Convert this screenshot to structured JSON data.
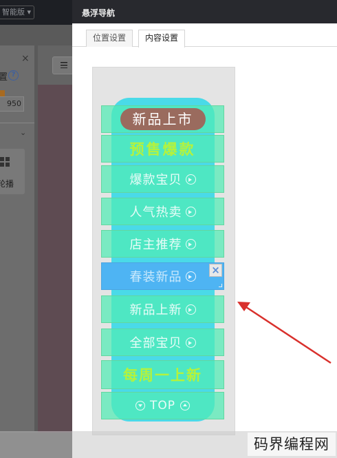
{
  "background_app": {
    "edition_label": "智能版 ▾",
    "panel_close": "×",
    "setting_label": "置",
    "help_icon_text": "?",
    "width_value": "950",
    "tile_label": "轮播"
  },
  "dialog": {
    "title": "悬浮导航",
    "tabs": [
      {
        "label": "位置设置",
        "active": false
      },
      {
        "label": "内容设置",
        "active": true
      }
    ]
  },
  "preview": {
    "nav_items": [
      {
        "label": "新品上市",
        "style": "badge"
      },
      {
        "label": "预售爆款",
        "style": "highlight"
      },
      {
        "label": "爆款宝贝",
        "style": "arrow"
      },
      {
        "label": "人气热卖",
        "style": "arrow"
      },
      {
        "label": "店主推荐",
        "style": "arrow"
      },
      {
        "label": "春装新品",
        "style": "selected-arrow"
      },
      {
        "label": "新品上新",
        "style": "arrow"
      },
      {
        "label": "全部宝贝",
        "style": "arrow"
      },
      {
        "label": "每周一上新",
        "style": "highlight"
      },
      {
        "label": "TOP",
        "style": "top"
      }
    ],
    "close_label": "×",
    "colors": {
      "pill": "#41d9e8",
      "row": "#50ebb4",
      "selected_row": "#4eb4f3",
      "highlight_text": "#b5f23c",
      "badge": "#9a6b5e",
      "annotation_arrow": "#d9302c"
    }
  },
  "watermark": "码界编程网"
}
